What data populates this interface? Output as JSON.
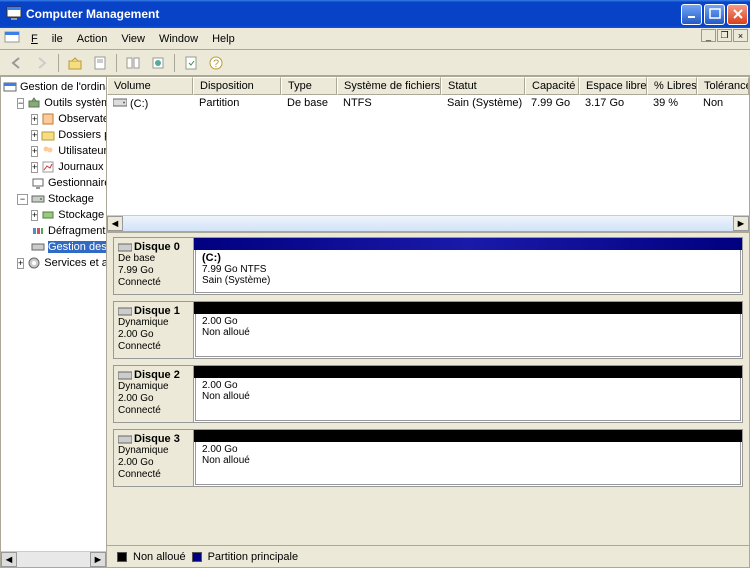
{
  "window": {
    "title": "Computer Management"
  },
  "menu": {
    "file": "File",
    "action": "Action",
    "view": "View",
    "window": "Window",
    "help": "Help"
  },
  "columns": {
    "volume": "Volume",
    "layout": "Disposition",
    "type": "Type",
    "fs": "Système de fichiers",
    "status": "Statut",
    "capacity": "Capacité",
    "free": "Espace libre",
    "pct": "% Libres",
    "tol": "Tolérance"
  },
  "tree": {
    "root": "Gestion de l'ordinateur (local)",
    "systools": "Outils système",
    "evt": "Observateur d'événements",
    "shared": "Dossiers partagés",
    "users": "Utilisateurs et groupes locau",
    "perf": "Journaux et alertes de perfo",
    "devmgr": "Gestionnaire de périphériqu",
    "storage": "Stockage",
    "removable": "Stockage amovible",
    "defrag": "Défragmenteur de disque",
    "diskmgmt": "Gestion des disques",
    "services": "Services et applications"
  },
  "volumes": [
    {
      "name": "(C:)",
      "layout": "Partition",
      "type": "De base",
      "fs": "NTFS",
      "status": "Sain (Système)",
      "capacity": "7.99 Go",
      "free": "3.17 Go",
      "pct": "39 %",
      "tol": "Non"
    }
  ],
  "disks": [
    {
      "name": "Disque 0",
      "dtype": "De base",
      "size": "7.99 Go",
      "state": "Connecté",
      "stripe": "blue",
      "part": {
        "title": "(C:)",
        "l1": "7.99 Go NTFS",
        "l2": "Sain (Système)"
      }
    },
    {
      "name": "Disque 1",
      "dtype": "Dynamique",
      "size": "2.00 Go",
      "state": "Connecté",
      "stripe": "black",
      "part": {
        "title": "",
        "l1": "2.00 Go",
        "l2": "Non alloué"
      }
    },
    {
      "name": "Disque 2",
      "dtype": "Dynamique",
      "size": "2.00 Go",
      "state": "Connecté",
      "stripe": "black",
      "part": {
        "title": "",
        "l1": "2.00 Go",
        "l2": "Non alloué"
      }
    },
    {
      "name": "Disque 3",
      "dtype": "Dynamique",
      "size": "2.00 Go",
      "state": "Connecté",
      "stripe": "black",
      "part": {
        "title": "",
        "l1": "2.00 Go",
        "l2": "Non alloué"
      }
    }
  ],
  "legend": {
    "unalloc": "Non alloué",
    "primary": "Partition principale"
  }
}
